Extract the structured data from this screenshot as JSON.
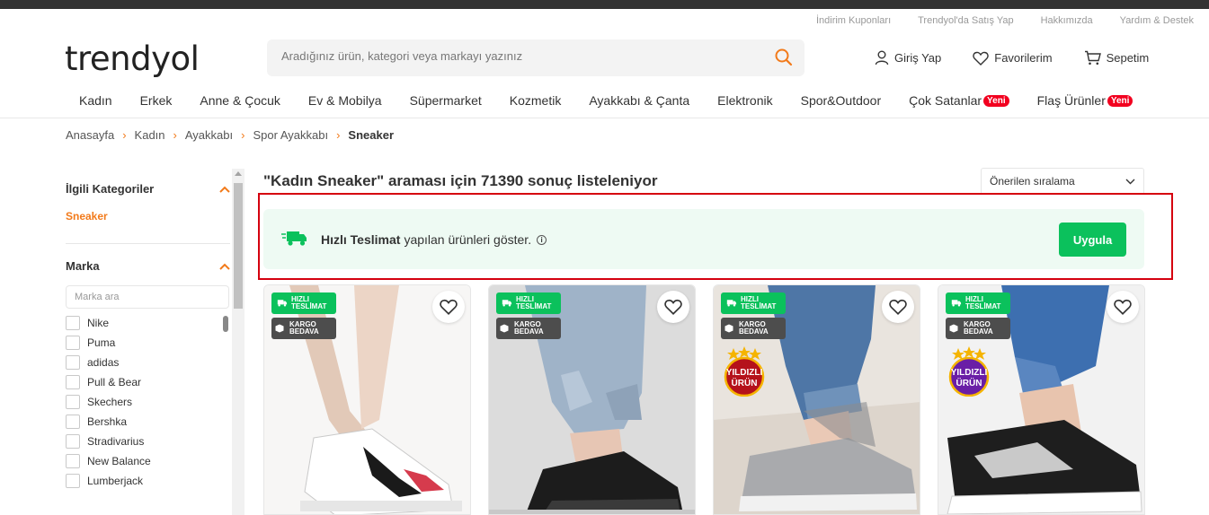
{
  "top_links": [
    "İndirim Kuponları",
    "Trendyol'da Satış Yap",
    "Hakkımızda",
    "Yardım & Destek"
  ],
  "logo": "trendyol",
  "search": {
    "placeholder": "Aradığınız ürün, kategori veya markayı yazınız"
  },
  "user_actions": {
    "login": "Giriş Yap",
    "favorites": "Favorilerim",
    "cart": "Sepetim"
  },
  "categories": [
    {
      "label": "Kadın"
    },
    {
      "label": "Erkek"
    },
    {
      "label": "Anne & Çocuk"
    },
    {
      "label": "Ev & Mobilya"
    },
    {
      "label": "Süpermarket"
    },
    {
      "label": "Kozmetik"
    },
    {
      "label": "Ayakkabı & Çanta"
    },
    {
      "label": "Elektronik"
    },
    {
      "label": "Spor&Outdoor"
    },
    {
      "label": "Çok Satanlar",
      "badge": "Yeni"
    },
    {
      "label": "Flaş Ürünler",
      "badge": "Yeni"
    }
  ],
  "breadcrumb": [
    "Anasayfa",
    "Kadın",
    "Ayakkabı",
    "Spor Ayakkabı",
    "Sneaker"
  ],
  "sidebar": {
    "related_title": "İlgili Kategoriler",
    "related_item": "Sneaker",
    "brand_title": "Marka",
    "brand_search_placeholder": "Marka ara",
    "brands": [
      "Nike",
      "Puma",
      "adidas",
      "Pull & Bear",
      "Skechers",
      "Bershka",
      "Stradivarius",
      "New Balance",
      "Lumberjack"
    ]
  },
  "results": {
    "text": "\"Kadın Sneaker\" araması için 71390 sonuç listeleniyor"
  },
  "sort": {
    "selected": "Önerilen sıralama"
  },
  "fast_delivery": {
    "bold": "Hızlı Teslimat",
    "rest": "yapılan ürünleri göster.",
    "button": "Uygula"
  },
  "badges": {
    "fast_1": "HIZLI",
    "fast_2": "TESLİMAT",
    "cargo_1": "KARGO",
    "cargo_2": "BEDAVA",
    "star_1": "YILDIZLI",
    "star_2": "ÜRÜN"
  },
  "colors": {
    "accent": "#f27a1a",
    "green": "#0bc15c",
    "badge_red": "#f2001f",
    "highlight": "#d5000f"
  }
}
